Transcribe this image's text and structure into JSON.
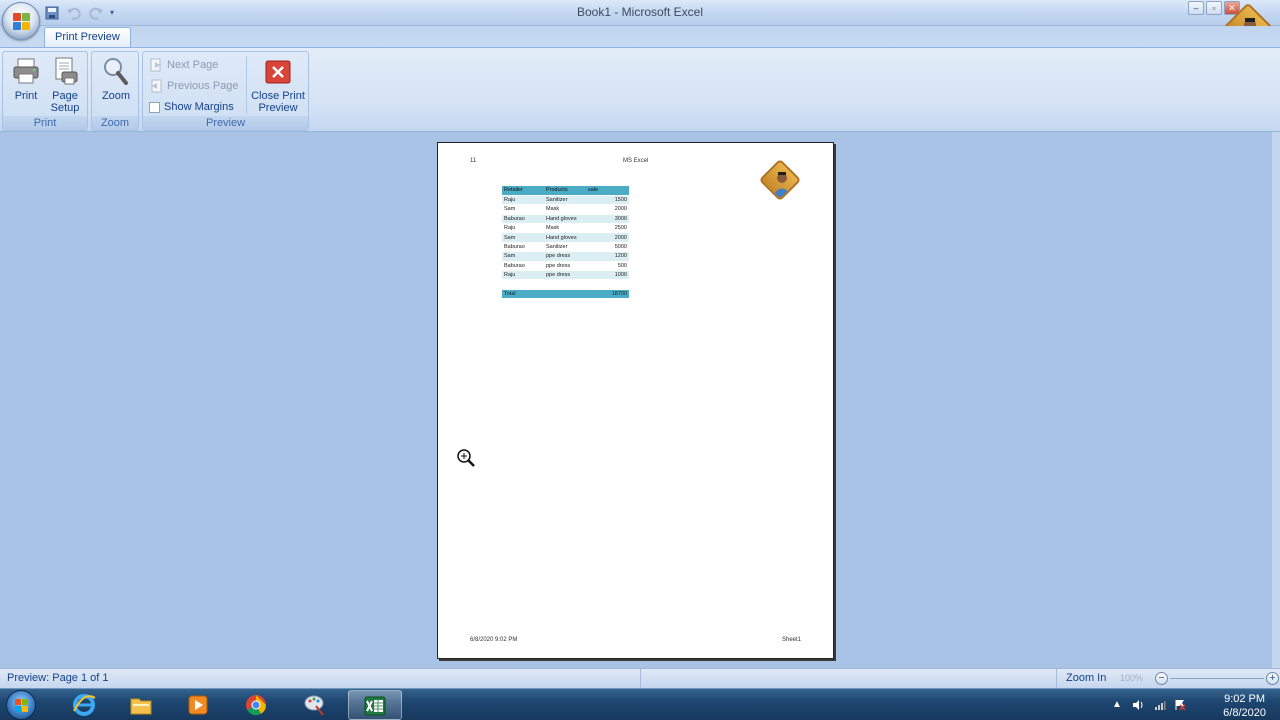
{
  "window": {
    "title": "Book1 - Microsoft Excel",
    "minimize": "–",
    "restore": "▫",
    "close": "✕"
  },
  "ribbon": {
    "active_tab": "Print Preview",
    "groups": {
      "print": {
        "label": "Print",
        "print_button": "Print",
        "page_setup_line1": "Page",
        "page_setup_line2": "Setup"
      },
      "zoom": {
        "label": "Zoom",
        "zoom_button": "Zoom"
      },
      "preview": {
        "label": "Preview",
        "next_page": "Next Page",
        "previous_page": "Previous Page",
        "show_margins": "Show Margins",
        "close_line1": "Close Print",
        "close_line2": "Preview"
      }
    }
  },
  "page": {
    "header_left": "11",
    "header_center": "MS Excel",
    "footer_left": "6/8/2020 9:02 PM",
    "footer_right": "Sheet1",
    "table": {
      "headers": [
        "Retailer",
        "Products",
        "sale"
      ],
      "rows": [
        [
          "Raju",
          "Sanitizer",
          "1500"
        ],
        [
          "Sam",
          "Mask",
          "2000"
        ],
        [
          "Baburao",
          "Hand gloves",
          "3000"
        ],
        [
          "Raju",
          "Mask",
          "2500"
        ],
        [
          "Sam",
          "Hand gloves",
          "2000"
        ],
        [
          "Baburao",
          "Sanitizer",
          "5000"
        ],
        [
          "Sam",
          "ppe dress",
          "1200"
        ],
        [
          "Baburao",
          "ppe dress",
          "500"
        ],
        [
          "Raju",
          "ppe dress",
          "1000"
        ],
        [
          "",
          "",
          ""
        ]
      ],
      "total": [
        "Total",
        "",
        "18700"
      ]
    }
  },
  "status": {
    "text": "Preview: Page 1 of 1",
    "zoom_in": "Zoom In",
    "zoom_percent": "100%"
  },
  "taskbar": {
    "time": "9:02 PM",
    "date": "6/8/2020"
  },
  "colors": {
    "table_header": "#4bacc6",
    "table_band": "#daeef3",
    "workspace": "#a9c3e6"
  }
}
